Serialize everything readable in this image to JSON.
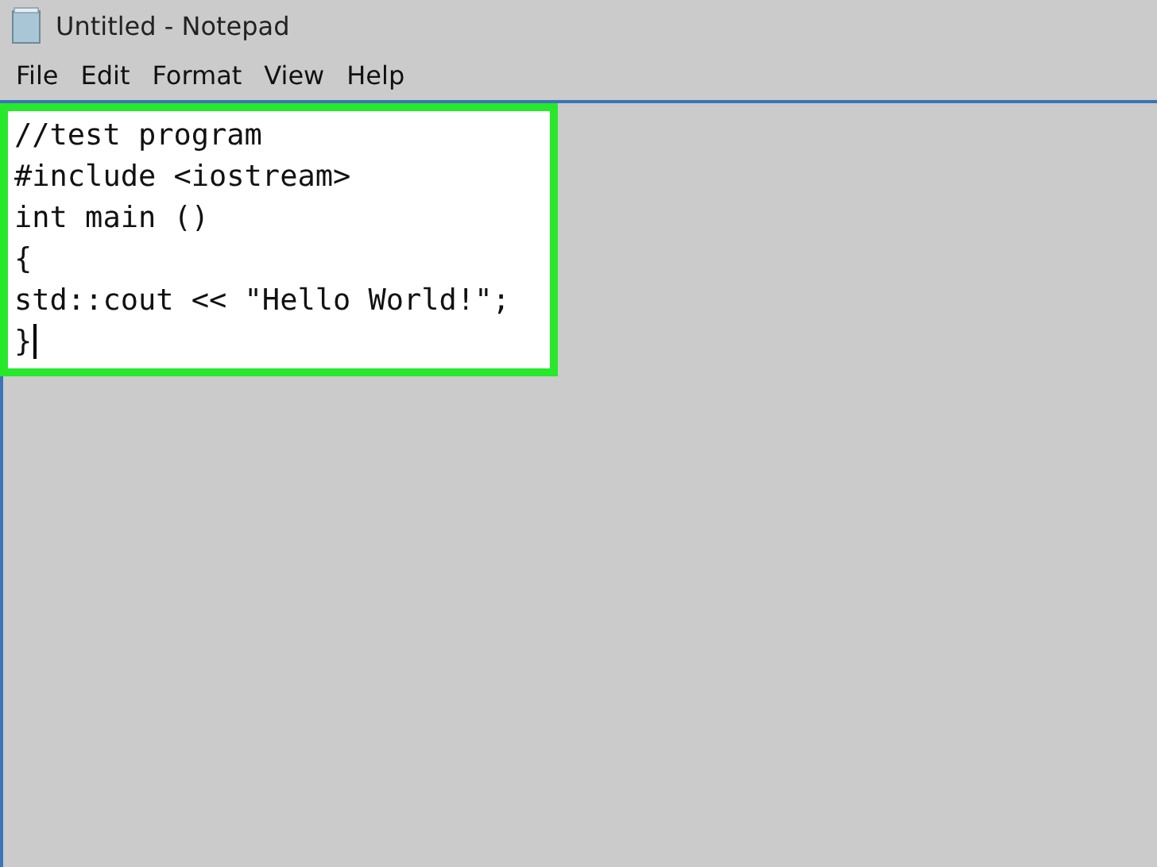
{
  "window": {
    "title": "Untitled - Notepad"
  },
  "menu": [
    "File",
    "Edit",
    "Format",
    "View",
    "Help"
  ],
  "editor": {
    "lines": [
      "//test program",
      "#include <iostream>",
      "int main ()",
      "{",
      "std::cout << \"Hello World!\";",
      "}"
    ]
  }
}
